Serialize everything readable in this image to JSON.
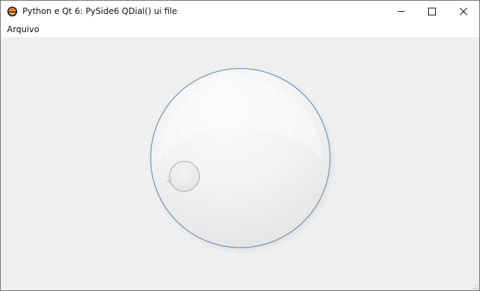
{
  "window": {
    "title": "Python e Qt 6: PySide6 QDial() ui file",
    "app_icon": "python-logo-icon",
    "controls": {
      "minimize_icon": "minimize-icon",
      "maximize_icon": "maximize-icon",
      "close_icon": "close-icon"
    }
  },
  "menubar": {
    "items": [
      {
        "label": "Arquivo"
      }
    ]
  },
  "dial": {
    "widget": "QDial",
    "value_fraction": 0.14,
    "colors": {
      "face": "#f3f3f3",
      "border": "#6d99c0",
      "knob_border": "#a7a7a7"
    }
  }
}
